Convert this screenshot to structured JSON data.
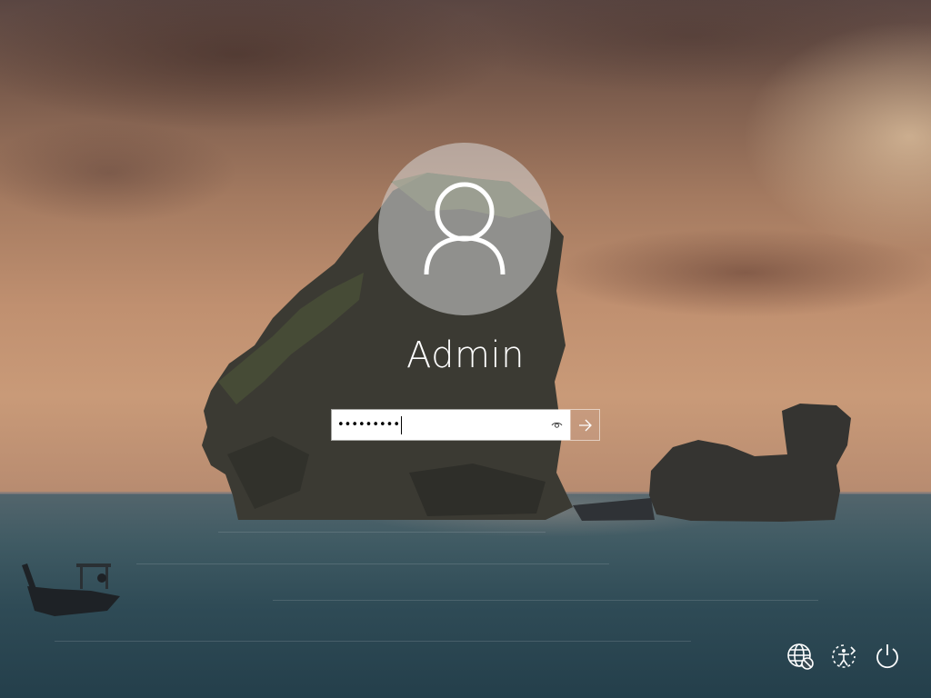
{
  "user": {
    "name": "Admin"
  },
  "password": {
    "masked_value": "•••••••••",
    "show_icon": "eye-icon",
    "submit_icon": "arrow-right-icon"
  },
  "tray": {
    "icons": [
      "network-icon",
      "accessibility-icon",
      "power-icon"
    ]
  }
}
